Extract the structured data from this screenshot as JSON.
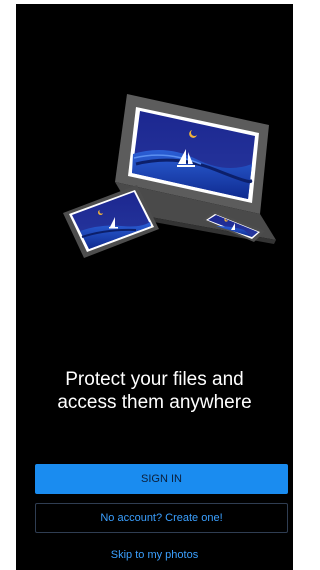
{
  "onboarding": {
    "headline_line1": "Protect your files and",
    "headline_line2": "access them anywhere",
    "sign_in_label": "SIGN IN",
    "create_account_label": "No account? Create one!",
    "skip_label": "Skip to my photos"
  },
  "illustration": {
    "icon": "devices-illustration",
    "scene": "night-sailboat"
  },
  "colors": {
    "background": "#000000",
    "accent": "#1a8cf0",
    "link": "#3ba0ff",
    "device_frame": "#5a5a5a",
    "scene_sky": "#1b2a8a"
  }
}
